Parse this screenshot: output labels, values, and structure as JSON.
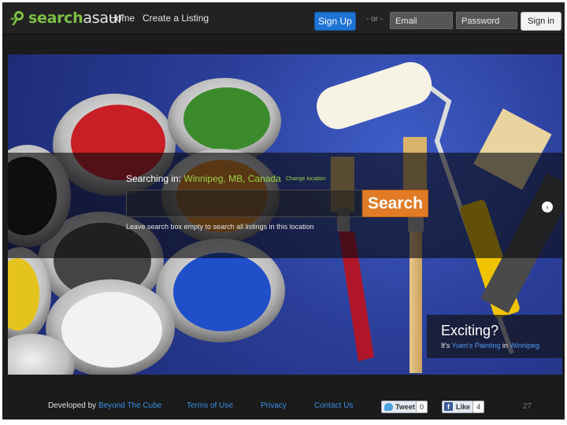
{
  "brand": {
    "name_a": "search",
    "name_b": "asaur",
    "accent": "#7cc043"
  },
  "nav": {
    "home": "Home",
    "create": "Create a Listing",
    "signup": "Sign Up",
    "or": "- or -",
    "email_placeholder": "Email",
    "password_placeholder": "Password",
    "signin": "Sign in"
  },
  "hero": {
    "searching_in": "Searching in:",
    "location": "Winnipeg, MB, Canada",
    "change_location": "Change location",
    "search_value": "",
    "search_button": "Search",
    "hint": "Leave search box empty to search all listings in this location",
    "next_icon": "chevron-right-icon",
    "feature": {
      "title": "Exciting?",
      "its": "It's",
      "business": "Yuen's Painting",
      "in": "in",
      "city": "Winnipeg"
    }
  },
  "footer": {
    "developed_by": "Developed by",
    "developer": "Beyond The Cube",
    "terms": "Terms of Use",
    "privacy": "Privacy",
    "contact": "Contact Us",
    "tweet": "Tweet",
    "tweet_count": "0",
    "like": "Like",
    "like_count": "4",
    "slide_number": "27"
  },
  "colors": {
    "signup": "#1e74d6",
    "search_button": "#e17b25",
    "link": "#3b8ee6",
    "location": "#9bd247"
  }
}
